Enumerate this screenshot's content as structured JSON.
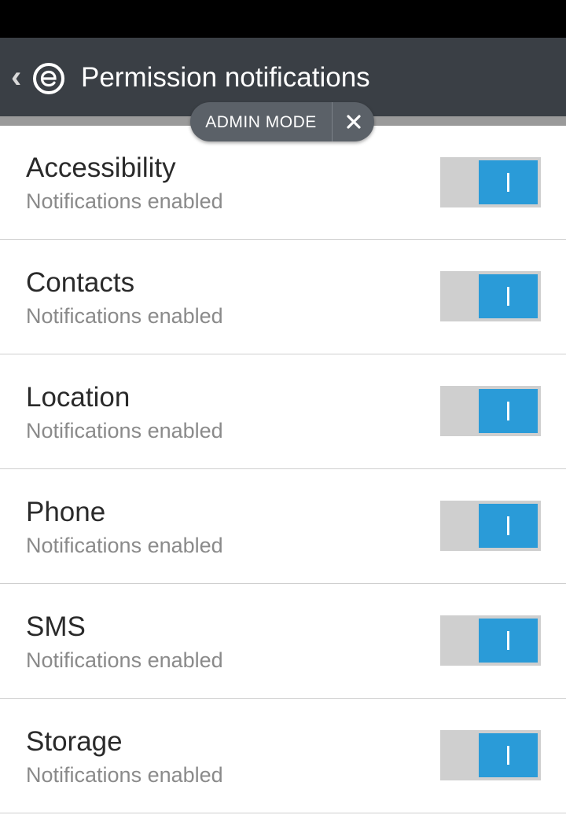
{
  "header": {
    "title": "Permission notifications"
  },
  "admin_mode": {
    "label": "ADMIN MODE"
  },
  "colors": {
    "app_bar": "#3a3f45",
    "accent": "#2a9bd8",
    "toggle_track": "#cfcfcf"
  },
  "permissions": [
    {
      "title": "Accessibility",
      "status": "Notifications enabled",
      "enabled": true
    },
    {
      "title": "Contacts",
      "status": "Notifications enabled",
      "enabled": true
    },
    {
      "title": "Location",
      "status": "Notifications enabled",
      "enabled": true
    },
    {
      "title": "Phone",
      "status": "Notifications enabled",
      "enabled": true
    },
    {
      "title": "SMS",
      "status": "Notifications enabled",
      "enabled": true
    },
    {
      "title": "Storage",
      "status": "Notifications enabled",
      "enabled": true
    }
  ]
}
